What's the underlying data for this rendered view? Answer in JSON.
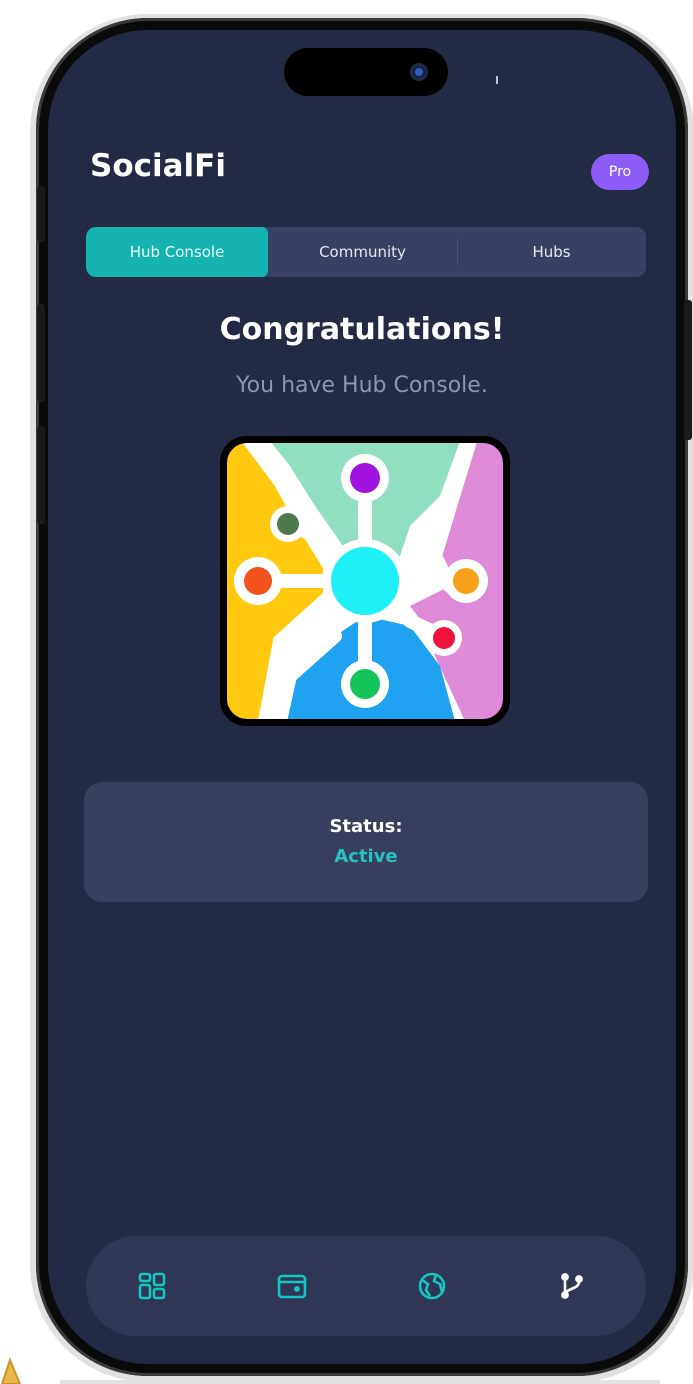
{
  "app": {
    "title": "SocialFi",
    "badge": "Pro"
  },
  "tabs": [
    {
      "label": "Hub Console",
      "active": true
    },
    {
      "label": "Community",
      "active": false
    },
    {
      "label": "Hubs",
      "active": false
    }
  ],
  "main": {
    "heading": "Congratulations!",
    "subheading": "You have Hub Console.",
    "hub_icon": "hub-network-icon"
  },
  "status": {
    "label": "Status:",
    "value": "Active"
  },
  "bottom_nav": [
    {
      "icon": "dashboard-grid-icon"
    },
    {
      "icon": "wallet-icon"
    },
    {
      "icon": "globe-icon"
    },
    {
      "icon": "git-branch-icon"
    }
  ],
  "colors": {
    "background": "#232a44",
    "accent": "#14b2b1",
    "status_active": "#25c2c0",
    "pro_badge": "#8b5cf6",
    "card": "#373f5d"
  }
}
